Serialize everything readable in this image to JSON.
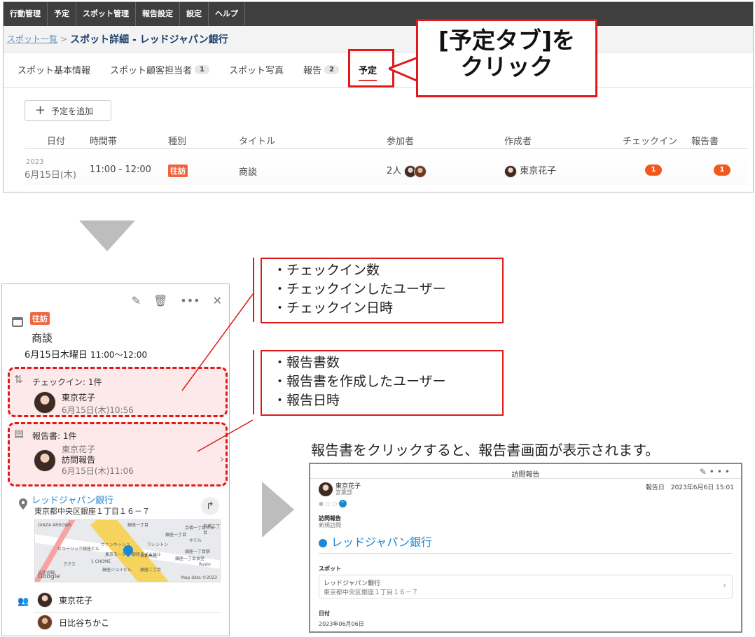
{
  "top_nav": [
    "行動管理",
    "予定",
    "スポット管理",
    "報告設定",
    "設定",
    "ヘルプ"
  ],
  "breadcrumb": {
    "link": "スポット一覧",
    "sep": ">",
    "title": "スポット詳細 - レッドジャパン銀行"
  },
  "tabs": [
    {
      "label": "スポット基本情報",
      "badge": ""
    },
    {
      "label": "スポット顧客担当者",
      "badge": "1"
    },
    {
      "label": "スポット写真",
      "badge": ""
    },
    {
      "label": "報告",
      "badge": "2"
    },
    {
      "label": "予定",
      "badge": "",
      "active": true
    }
  ],
  "add_button": "予定を追加",
  "table": {
    "headers": [
      "日付",
      "時間帯",
      "種別",
      "タイトル",
      "参加者",
      "作成者",
      "チェックイン",
      "報告書"
    ],
    "row": {
      "year": "2023",
      "date": "6月15日(木)",
      "time": "11:00 - 12:00",
      "type": "往訪",
      "title": "商談",
      "participants": "2人",
      "creator": "東京花子",
      "checkin": "1",
      "report": "1"
    }
  },
  "callout_top": {
    "line1": "[予定タブ]を",
    "line2": "クリック"
  },
  "panel": {
    "tag": "往訪",
    "title": "商談",
    "date": "6月15日木曜日",
    "time": "11:00〜12:00",
    "checkin": {
      "head": "チェックイン: 1件",
      "name": "東京花子",
      "time": "6月15日(木)10:56"
    },
    "report": {
      "head": "報告書: 1件",
      "author": "東京花子",
      "name": "訪問報告",
      "time": "6月15日(木)11:06"
    },
    "location": {
      "name": "レッドジャパン銀行",
      "address": "東京都中央区銀座１丁目１６－７"
    },
    "map": {
      "labels": [
        "GINZA ARROWS",
        "銀座一丁目",
        "ヒューリック銀座ビル",
        "ヴァンキッシュ",
        "1 CHOME",
        "ラクス",
        "東京モーター\n銀座スイムビル",
        "ワシントン",
        "Rusto",
        "銀座ジョイビル",
        "銀座一丁目",
        "銀座一丁目駅",
        "京橋一丁目ビル",
        "ホテル",
        "首都高速",
        "銀座一丁目食堂",
        "京橋三丁目",
        "銀座二丁目",
        "日比谷線"
      ],
      "logo": "Google",
      "copyright": "Map data ©2023"
    },
    "people": [
      "東京花子",
      "日比谷ちかこ"
    ]
  },
  "callout_checkin": [
    "チェックイン数",
    "チェックインしたユーザー",
    "チェックイン日時"
  ],
  "callout_report": [
    "報告書数",
    "報告書を作成したユーザー",
    "報告日時"
  ],
  "caption": "報告書をクリックすると、報告書画面が表示されます。",
  "report_screen": {
    "title": "訪問報告",
    "user": "東京花子",
    "dept": "営業部",
    "date": "報告日　2023年6月6日 15:01",
    "heading": "訪問報告",
    "subheading": "新規訪問",
    "bank": "レッドジャパン銀行",
    "spot_label": "スポット",
    "spot_name": "レッドジャパン銀行",
    "spot_address": "東京都中央区銀座１丁目１６－７",
    "date_label": "日付",
    "date_value": "2023年06月06日"
  },
  "colors": {
    "accent_red": "#e01a1a",
    "tag_orange": "#f0643e",
    "link_blue": "#1e88d4",
    "nav_dark": "#3f3f3f"
  }
}
